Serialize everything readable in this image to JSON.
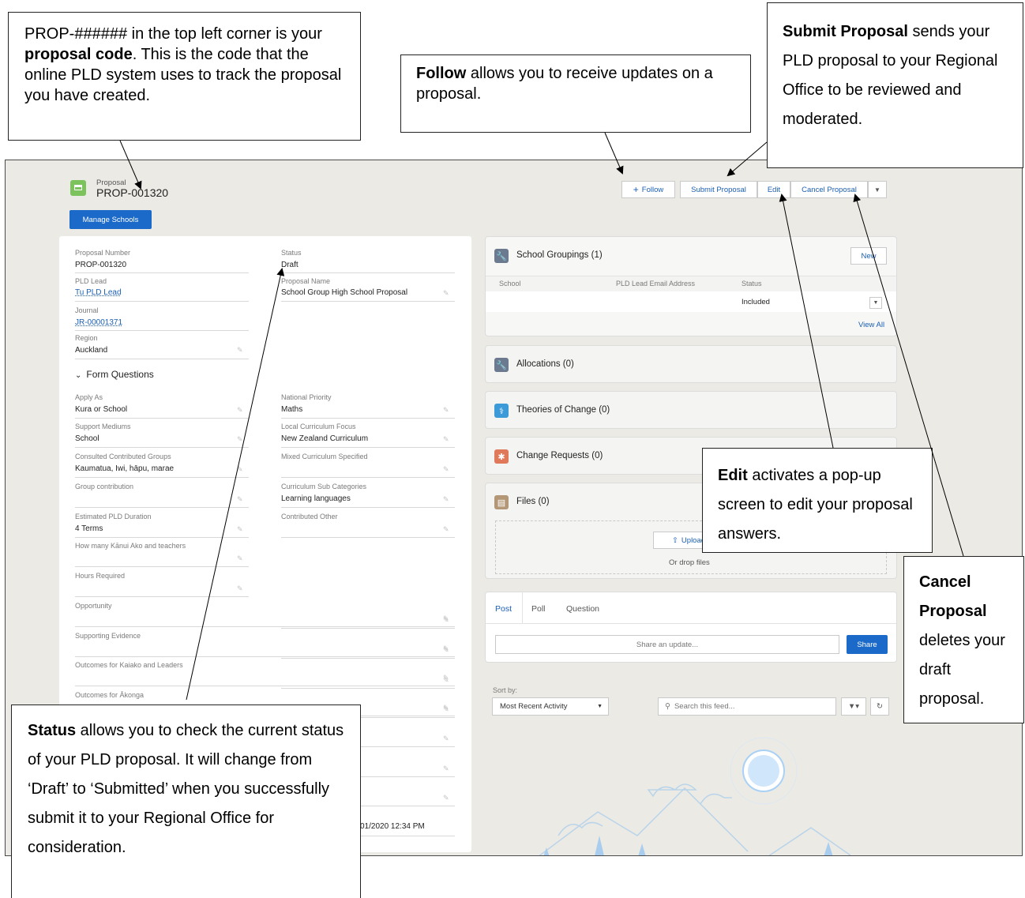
{
  "record": {
    "object_label": "Proposal",
    "code": "PROP-001320",
    "manage_schools_label": "Manage Schools"
  },
  "actions": {
    "follow_label": "Follow",
    "submit_label": "Submit Proposal",
    "edit_label": "Edit",
    "cancel_label": "Cancel Proposal"
  },
  "details": {
    "proposal_number_label": "Proposal Number",
    "proposal_number": "PROP-001320",
    "pld_lead_label": "PLD Lead",
    "pld_lead": "Tu PLD Lead",
    "journal_label": "Journal",
    "journal": "JR-00001371",
    "region_label": "Region",
    "region": "Auckland",
    "status_label": "Status",
    "status": "Draft",
    "proposal_name_label": "Proposal Name",
    "proposal_name": "School Group High School Proposal",
    "form_questions_label": "Form Questions",
    "left_fields": [
      {
        "label": "Apply As",
        "value": "Kura or School"
      },
      {
        "label": "Support Mediums",
        "value": "School"
      },
      {
        "label": "Consulted Contributed Groups",
        "value": "Kaumatua, Iwi, hāpu, marae"
      },
      {
        "label": "Group contribution",
        "value": ""
      },
      {
        "label": "Estimated PLD Duration",
        "value": "4 Terms"
      },
      {
        "label": "How many Kānui Ako and teachers",
        "value": ""
      },
      {
        "label": "Hours Required",
        "value": ""
      },
      {
        "label": "Opportunity",
        "value": ""
      },
      {
        "label": "Supporting Evidence",
        "value": ""
      },
      {
        "label": "Outcomes for Kaiako and Leaders",
        "value": ""
      },
      {
        "label": "Outcomes for Ākonga",
        "value": ""
      }
    ],
    "right_fields": [
      {
        "label": "National Priority",
        "value": "Maths"
      },
      {
        "label": "Local Curriculum Focus",
        "value": "New Zealand Curriculum"
      },
      {
        "label": "Mixed Curriculum Specified",
        "value": ""
      },
      {
        "label": "Curriculum Sub Categories",
        "value": "Learning languages"
      },
      {
        "label": "Contributed Other",
        "value": ""
      }
    ],
    "timestamp_partial": "01/2020 12:34 PM"
  },
  "related": {
    "school_groupings_title": "School Groupings (1)",
    "new_label": "New",
    "col_school": "School",
    "col_email": "PLD Lead Email Address",
    "col_status": "Status",
    "row_status": "Included",
    "view_all_label": "View All",
    "allocations_title": "Allocations (0)",
    "theories_title": "Theories of Change (0)",
    "change_requests_title": "Change Requests (0)",
    "files_title": "Files (0)",
    "upload_label": "Upload",
    "drop_label": "Or drop files"
  },
  "feed": {
    "tabs": [
      "Post",
      "Poll",
      "Question"
    ],
    "share_placeholder": "Share an update...",
    "share_label": "Share",
    "sort_by_label": "Sort by:",
    "sort_value": "Most Recent Activity",
    "search_placeholder": "Search this feed..."
  },
  "callouts": {
    "code_pre": "PROP-###### in the top left corner is your ",
    "code_bold": "proposal code",
    "code_post": ". This is the code that the online PLD system uses to track the proposal you have created.",
    "follow_bold": "Follow",
    "follow_post": " allows you to receive updates on a proposal.",
    "submit_bold": "Submit Proposal",
    "submit_post": " sends your PLD proposal to your Regional Office to be reviewed and moderated.",
    "edit_bold": "Edit",
    "edit_post": " activates a pop-up screen to edit your proposal answers.",
    "cancel_bold": "Cancel Proposal",
    "cancel_post": " deletes your draft proposal.",
    "status_bold": "Status",
    "status_post": " allows you to check the current status of your PLD proposal. It will change from ‘Draft’ to ‘Submitted’ when you successfully submit it to your Regional Office for consideration."
  },
  "colors": {
    "brand_blue": "#1b6ac9",
    "proposal_icon_green": "#7cc35e",
    "page_bg": "#eceae4"
  }
}
